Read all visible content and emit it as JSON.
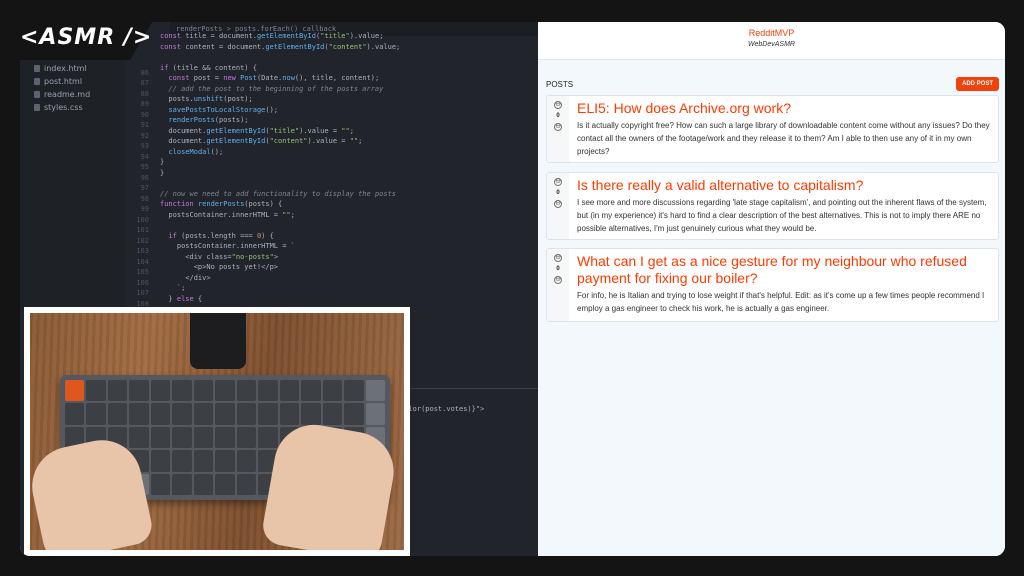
{
  "brand": {
    "label": "<ASMR />"
  },
  "editor": {
    "tab_breadcrumb": "renderPosts > posts.forEach() callback",
    "files": [
      "index.html",
      "post.html",
      "readme.md",
      "styles.css"
    ],
    "line_numbers": [
      "",
      "",
      "",
      "86",
      "87",
      "88",
      "89",
      "90",
      "91",
      "92",
      "93",
      "94",
      "95",
      "96",
      "97",
      "98",
      "99",
      "100",
      "101",
      "102",
      "103",
      "104",
      "105",
      "106",
      "107",
      "108"
    ],
    "code_lines": [
      "const title = document.getElementById(\"title\").value;",
      "const content = document.getElementById(\"content\").value;",
      "",
      "if (title && content) {",
      "  const post = new Post(Date.now(), title, content);",
      "  // add the post to the beginning of the posts array",
      "  posts.unshift(post);",
      "  savePostsToLocalStorage();",
      "  renderPosts(posts);",
      "  document.getElementById(\"title\").value = \"\";",
      "  document.getElementById(\"content\").value = \"\";",
      "  closeModal();",
      "}",
      "}",
      "",
      "// now we need to add functionality to display the posts",
      "function renderPosts(posts) {",
      "  postsContainer.innerHTML = \"\";",
      "",
      "  if (posts.length === 0) {",
      "    postsContainer.innerHTML = `",
      "      <div class=\"no-posts\">",
      "        <p>No posts yet!</p>",
      "      </div>",
      "    `;",
      "  } else {"
    ],
    "code_fragments": [
      "Color(post.votes)}\">",
      "\">"
    ]
  },
  "app": {
    "title": "RedditMVP",
    "subtitle": "WebDevASMR",
    "posts_heading": "POSTS",
    "add_post_label": "ADD POST",
    "upvote_glyph": "⊖",
    "downvote_glyph": "⊖",
    "posts": [
      {
        "votes": "0",
        "title": "ELI5: How does Archive.org work?",
        "content": "Is it actually copyright free? How can such a large library of downloadable content come without any issues? Do they contact all the owners of the footage/work and they release it to them? Am I able to then use any of it in my own projects?"
      },
      {
        "votes": "0",
        "title": "Is there really a valid alternative to capitalism?",
        "content": "I see more and more discussions regarding 'late stage capitalism', and pointing out the inherent flaws of the system, but (in my experience) it's hard to find a clear description of the best alternatives. This is not to imply there ARE no possible alternatives, I'm just genuinely curious what they would be."
      },
      {
        "votes": "0",
        "title": "What can I get as a nice gesture for my neighbour who refused payment for fixing our boiler?",
        "content": "For info, he is Italian and trying to lose weight if that's helpful. Edit: as it's come up a few times people recommend I employ a gas engineer to check his work, he is actually a gas engineer."
      }
    ]
  }
}
